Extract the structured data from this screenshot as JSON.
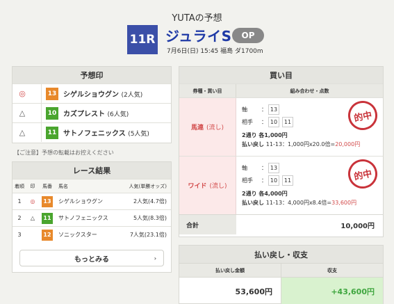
{
  "header": {
    "title": "YUTAの予想",
    "race_no": "11R",
    "race_name": "ジュライS",
    "grade": "OP",
    "info": "7月6日(日) 15:45 福島 ダ1700m"
  },
  "prediction": {
    "heading": "予想印",
    "rows": [
      {
        "mark": "◎",
        "num": "13",
        "num_color": "#e8892b",
        "name": "シゲルショウグン",
        "pop": "(2人気)"
      },
      {
        "mark": "△",
        "num": "10",
        "num_color": "#4aa52e",
        "name": "カズプレスト",
        "pop": "(6人気)"
      },
      {
        "mark": "△",
        "num": "11",
        "num_color": "#4aa52e",
        "name": "サトノフェニックス",
        "pop": "(5人気)"
      }
    ],
    "note": "【ご注意】予想の転載はお控えください"
  },
  "results": {
    "heading": "レース結果",
    "columns": {
      "rank": "着順",
      "mark": "印",
      "num": "馬番",
      "name": "馬名",
      "pop": "人気(単勝オッズ)"
    },
    "rows": [
      {
        "rank": "1",
        "mark": "◎",
        "num": "13",
        "num_color": "#e8892b",
        "name": "シゲルショウグン",
        "pop": "2人気(4.7倍)"
      },
      {
        "rank": "2",
        "mark": "△",
        "num": "11",
        "num_color": "#4aa52e",
        "name": "サトノフェニックス",
        "pop": "5人気(8.3倍)"
      },
      {
        "rank": "3",
        "mark": "",
        "num": "12",
        "num_color": "#e8892b",
        "name": "ソニックスター",
        "pop": "7人気(23.1倍)"
      }
    ],
    "more_label": "もっとみる"
  },
  "bets": {
    "heading": "買い目",
    "col_type": "券種・買い目",
    "col_combo": "組み合わせ・点数",
    "axis_label": "軸",
    "partner_label": "相手",
    "colon": "：",
    "stamp": "的中",
    "items": [
      {
        "type": "馬連",
        "sub": "(流し)",
        "axis": "13",
        "partners": [
          "10",
          "11"
        ],
        "summary": "2通り 各1,000円",
        "pay_label": "払い戻し",
        "pay_calc": "11-13：1,000円x20.0倍=",
        "pay_amount": "20,000円"
      },
      {
        "type": "ワイド",
        "sub": "(流し)",
        "axis": "13",
        "partners": [
          "10",
          "11"
        ],
        "summary": "2通り 各4,000円",
        "pay_label": "払い戻し",
        "pay_calc": "11-13：4,000円x8.4倍=",
        "pay_amount": "33,600円"
      }
    ],
    "total_label": "合計",
    "total_value": "10,000円"
  },
  "refund": {
    "heading": "払い戻し・収支",
    "col_payout": "払い戻し金額",
    "col_balance": "収支",
    "payout": "53,600円",
    "balance": "+43,600円"
  }
}
